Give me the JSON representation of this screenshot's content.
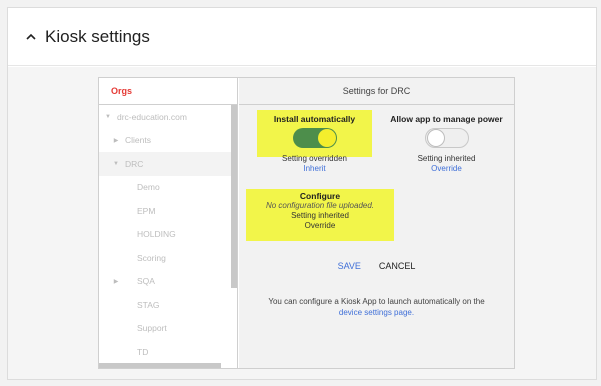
{
  "section": {
    "title": "Kiosk settings"
  },
  "orgs": {
    "header": "Orgs",
    "items": [
      {
        "label": "drc-education.com",
        "arrow": "▼",
        "indent": 0
      },
      {
        "label": "Clients",
        "arrow": "▶",
        "indent": 1
      },
      {
        "label": "DRC",
        "arrow": "▼",
        "indent": 1,
        "selected": true
      },
      {
        "label": "Demo",
        "arrow": "",
        "indent": 2
      },
      {
        "label": "EPM",
        "arrow": "",
        "indent": 2
      },
      {
        "label": "HOLDING",
        "arrow": "",
        "indent": 2
      },
      {
        "label": "Scoring",
        "arrow": "",
        "indent": 2
      },
      {
        "label": "SQA",
        "arrow": "▶",
        "indent": 2
      },
      {
        "label": "STAG",
        "arrow": "",
        "indent": 2
      },
      {
        "label": "Support",
        "arrow": "",
        "indent": 2
      },
      {
        "label": "TD",
        "arrow": "",
        "indent": 2
      }
    ]
  },
  "settings": {
    "header": "Settings for DRC",
    "install": {
      "title": "Install automatically",
      "toggle": "on",
      "status": "Setting overridden",
      "link": "Inherit"
    },
    "power": {
      "title": "Allow app to manage power",
      "toggle": "off",
      "status": "Setting inherited",
      "link": "Override"
    },
    "configure": {
      "title": "Configure",
      "note": "No configuration file uploaded.",
      "status": "Setting inherited",
      "link": "Override"
    },
    "save_label": "SAVE",
    "cancel_label": "CANCEL",
    "footnote_text": "You can configure a Kiosk App to launch automatically on the",
    "footnote_link": "device settings page."
  },
  "colors": {
    "highlight": "#f2f54a",
    "toggle_on": "#4d8e4b",
    "knob_on": "#f4ee2d",
    "link": "#3f6fd8",
    "orgs_header": "#e53935"
  }
}
